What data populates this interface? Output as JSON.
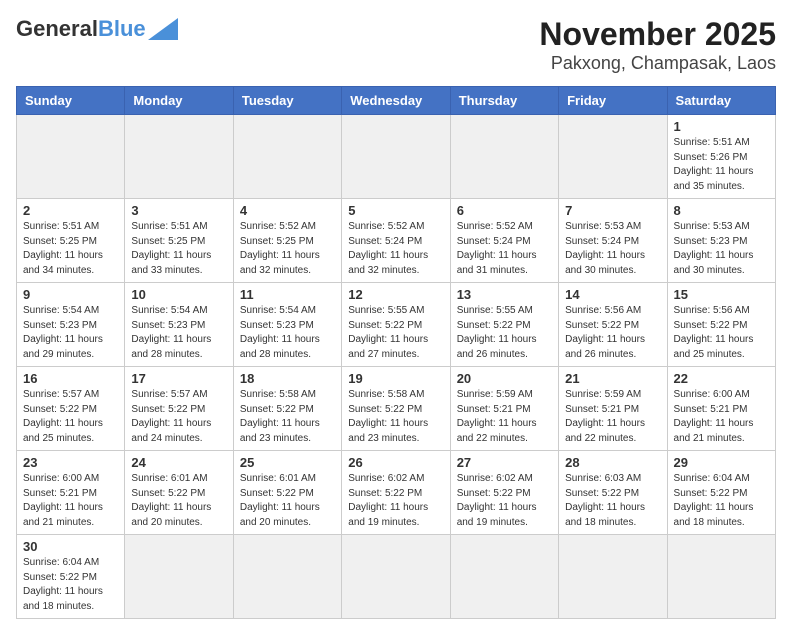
{
  "header": {
    "logo_general": "General",
    "logo_blue": "Blue",
    "title": "November 2025",
    "subtitle": "Pakxong, Champasak, Laos"
  },
  "weekdays": [
    "Sunday",
    "Monday",
    "Tuesday",
    "Wednesday",
    "Thursday",
    "Friday",
    "Saturday"
  ],
  "weeks": [
    [
      {
        "day": "",
        "info": ""
      },
      {
        "day": "",
        "info": ""
      },
      {
        "day": "",
        "info": ""
      },
      {
        "day": "",
        "info": ""
      },
      {
        "day": "",
        "info": ""
      },
      {
        "day": "",
        "info": ""
      },
      {
        "day": "1",
        "info": "Sunrise: 5:51 AM\nSunset: 5:26 PM\nDaylight: 11 hours\nand 35 minutes."
      }
    ],
    [
      {
        "day": "2",
        "info": "Sunrise: 5:51 AM\nSunset: 5:25 PM\nDaylight: 11 hours\nand 34 minutes."
      },
      {
        "day": "3",
        "info": "Sunrise: 5:51 AM\nSunset: 5:25 PM\nDaylight: 11 hours\nand 33 minutes."
      },
      {
        "day": "4",
        "info": "Sunrise: 5:52 AM\nSunset: 5:25 PM\nDaylight: 11 hours\nand 32 minutes."
      },
      {
        "day": "5",
        "info": "Sunrise: 5:52 AM\nSunset: 5:24 PM\nDaylight: 11 hours\nand 32 minutes."
      },
      {
        "day": "6",
        "info": "Sunrise: 5:52 AM\nSunset: 5:24 PM\nDaylight: 11 hours\nand 31 minutes."
      },
      {
        "day": "7",
        "info": "Sunrise: 5:53 AM\nSunset: 5:24 PM\nDaylight: 11 hours\nand 30 minutes."
      },
      {
        "day": "8",
        "info": "Sunrise: 5:53 AM\nSunset: 5:23 PM\nDaylight: 11 hours\nand 30 minutes."
      }
    ],
    [
      {
        "day": "9",
        "info": "Sunrise: 5:54 AM\nSunset: 5:23 PM\nDaylight: 11 hours\nand 29 minutes."
      },
      {
        "day": "10",
        "info": "Sunrise: 5:54 AM\nSunset: 5:23 PM\nDaylight: 11 hours\nand 28 minutes."
      },
      {
        "day": "11",
        "info": "Sunrise: 5:54 AM\nSunset: 5:23 PM\nDaylight: 11 hours\nand 28 minutes."
      },
      {
        "day": "12",
        "info": "Sunrise: 5:55 AM\nSunset: 5:22 PM\nDaylight: 11 hours\nand 27 minutes."
      },
      {
        "day": "13",
        "info": "Sunrise: 5:55 AM\nSunset: 5:22 PM\nDaylight: 11 hours\nand 26 minutes."
      },
      {
        "day": "14",
        "info": "Sunrise: 5:56 AM\nSunset: 5:22 PM\nDaylight: 11 hours\nand 26 minutes."
      },
      {
        "day": "15",
        "info": "Sunrise: 5:56 AM\nSunset: 5:22 PM\nDaylight: 11 hours\nand 25 minutes."
      }
    ],
    [
      {
        "day": "16",
        "info": "Sunrise: 5:57 AM\nSunset: 5:22 PM\nDaylight: 11 hours\nand 25 minutes."
      },
      {
        "day": "17",
        "info": "Sunrise: 5:57 AM\nSunset: 5:22 PM\nDaylight: 11 hours\nand 24 minutes."
      },
      {
        "day": "18",
        "info": "Sunrise: 5:58 AM\nSunset: 5:22 PM\nDaylight: 11 hours\nand 23 minutes."
      },
      {
        "day": "19",
        "info": "Sunrise: 5:58 AM\nSunset: 5:22 PM\nDaylight: 11 hours\nand 23 minutes."
      },
      {
        "day": "20",
        "info": "Sunrise: 5:59 AM\nSunset: 5:21 PM\nDaylight: 11 hours\nand 22 minutes."
      },
      {
        "day": "21",
        "info": "Sunrise: 5:59 AM\nSunset: 5:21 PM\nDaylight: 11 hours\nand 22 minutes."
      },
      {
        "day": "22",
        "info": "Sunrise: 6:00 AM\nSunset: 5:21 PM\nDaylight: 11 hours\nand 21 minutes."
      }
    ],
    [
      {
        "day": "23",
        "info": "Sunrise: 6:00 AM\nSunset: 5:21 PM\nDaylight: 11 hours\nand 21 minutes."
      },
      {
        "day": "24",
        "info": "Sunrise: 6:01 AM\nSunset: 5:22 PM\nDaylight: 11 hours\nand 20 minutes."
      },
      {
        "day": "25",
        "info": "Sunrise: 6:01 AM\nSunset: 5:22 PM\nDaylight: 11 hours\nand 20 minutes."
      },
      {
        "day": "26",
        "info": "Sunrise: 6:02 AM\nSunset: 5:22 PM\nDaylight: 11 hours\nand 19 minutes."
      },
      {
        "day": "27",
        "info": "Sunrise: 6:02 AM\nSunset: 5:22 PM\nDaylight: 11 hours\nand 19 minutes."
      },
      {
        "day": "28",
        "info": "Sunrise: 6:03 AM\nSunset: 5:22 PM\nDaylight: 11 hours\nand 18 minutes."
      },
      {
        "day": "29",
        "info": "Sunrise: 6:04 AM\nSunset: 5:22 PM\nDaylight: 11 hours\nand 18 minutes."
      }
    ],
    [
      {
        "day": "30",
        "info": "Sunrise: 6:04 AM\nSunset: 5:22 PM\nDaylight: 11 hours\nand 18 minutes."
      },
      {
        "day": "",
        "info": ""
      },
      {
        "day": "",
        "info": ""
      },
      {
        "day": "",
        "info": ""
      },
      {
        "day": "",
        "info": ""
      },
      {
        "day": "",
        "info": ""
      },
      {
        "day": "",
        "info": ""
      }
    ]
  ]
}
